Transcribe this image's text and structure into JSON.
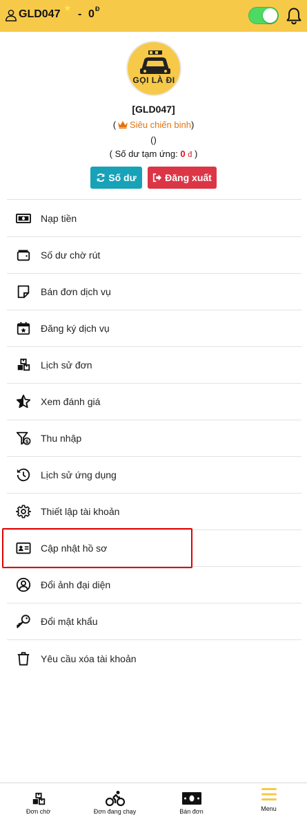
{
  "header": {
    "username": "GLD047",
    "star": "★",
    "separator": "-",
    "balance": "0",
    "currency_mark": "Đ",
    "online_toggle": "on"
  },
  "profile": {
    "avatar_logo_text": "GỌI LÀ ĐI",
    "name": "[GLD047]",
    "rank_open": "(",
    "rank": "Siêu chiến binh",
    "rank_close": ")",
    "extra": "()",
    "advance_prefix": "( Số dư tạm ứng:",
    "advance_amount": "0",
    "advance_unit": "đ",
    "advance_suffix": ")",
    "balance_button": "Số dư",
    "logout_button": "Đăng xuất"
  },
  "menu": {
    "items": [
      {
        "label": "Nạp tiền",
        "icon": "money-bill-icon"
      },
      {
        "label": "Số dư chờ rút",
        "icon": "wallet-icon"
      },
      {
        "label": "Bán đơn dịch vụ",
        "icon": "sticky-note-icon"
      },
      {
        "label": "Đăng ký dịch vụ",
        "icon": "calendar-star-icon"
      },
      {
        "label": "Lịch sử đơn",
        "icon": "boxes-icon"
      },
      {
        "label": "Xem đánh giá",
        "icon": "star-half-icon"
      },
      {
        "label": "Thu nhập",
        "icon": "funnel-dollar-icon"
      },
      {
        "label": "Lịch sử ứng dụng",
        "icon": "history-icon"
      },
      {
        "label": "Thiết lập tài khoản",
        "icon": "gear-icon"
      },
      {
        "label": "Cập nhật hồ sơ",
        "icon": "id-card-icon"
      },
      {
        "label": "Đổi ảnh đại diện",
        "icon": "user-circle-icon"
      },
      {
        "label": "Đổi mật khẩu",
        "icon": "key-icon"
      },
      {
        "label": "Yêu cầu xóa tài khoản",
        "icon": "trash-icon"
      }
    ]
  },
  "bottom_nav": {
    "items": [
      {
        "label": "Đơn chờ",
        "icon": "boxes-icon"
      },
      {
        "label": "Đơn đang chạy",
        "icon": "cyclist-icon"
      },
      {
        "label": "Bán đơn",
        "icon": "money-bill-icon"
      },
      {
        "label": "Menu",
        "icon": "hamburger-icon",
        "active": true
      }
    ]
  },
  "colors": {
    "header_bg": "#f7c948",
    "balance_button": "#17a2b8",
    "logout_button": "#dc3545",
    "rank": "#e5730d",
    "highlight": "#e00000",
    "menu_active": "#f7c948"
  }
}
